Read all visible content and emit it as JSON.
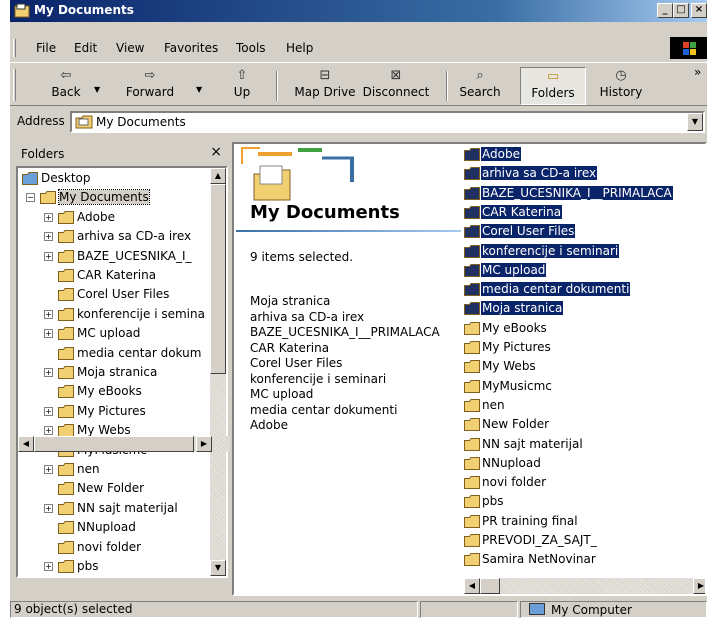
{
  "window": {
    "title": "My Documents"
  },
  "menu": [
    "File",
    "Edit",
    "View",
    "Favorites",
    "Tools",
    "Help"
  ],
  "toolbar": {
    "back": "Back",
    "forward": "Forward",
    "up": "Up",
    "map_drive": "Map Drive",
    "disconnect": "Disconnect",
    "search": "Search",
    "folders": "Folders",
    "history": "History",
    "more": "»"
  },
  "address": {
    "label": "Address",
    "value": "My Documents"
  },
  "folders_pane": {
    "title": "Folders",
    "close": "×",
    "tree": [
      {
        "label": "Desktop",
        "level": 0,
        "expander": ""
      },
      {
        "label": "My Documents",
        "level": 1,
        "expander": "−"
      },
      {
        "label": "Adobe",
        "level": 2,
        "expander": "+"
      },
      {
        "label": "arhiva sa CD-a irex",
        "level": 2,
        "expander": "+"
      },
      {
        "label": "BAZE_UCESNIKA_I_",
        "level": 2,
        "expander": "+"
      },
      {
        "label": "CAR Katerina",
        "level": 2,
        "expander": ""
      },
      {
        "label": "Corel User Files",
        "level": 2,
        "expander": ""
      },
      {
        "label": "konferencije i semina",
        "level": 2,
        "expander": "+"
      },
      {
        "label": "MC upload",
        "level": 2,
        "expander": "+"
      },
      {
        "label": "media centar dokum",
        "level": 2,
        "expander": ""
      },
      {
        "label": "Moja stranica",
        "level": 2,
        "expander": "+"
      },
      {
        "label": "My eBooks",
        "level": 2,
        "expander": ""
      },
      {
        "label": "My Pictures",
        "level": 2,
        "expander": "+"
      },
      {
        "label": "My Webs",
        "level": 2,
        "expander": "+"
      },
      {
        "label": "MyMusicmc",
        "level": 2,
        "expander": ""
      },
      {
        "label": "nen",
        "level": 2,
        "expander": "+"
      },
      {
        "label": "New Folder",
        "level": 2,
        "expander": ""
      },
      {
        "label": "NN sajt materijal",
        "level": 2,
        "expander": "+"
      },
      {
        "label": "NNupload",
        "level": 2,
        "expander": ""
      },
      {
        "label": "novi folder",
        "level": 2,
        "expander": ""
      },
      {
        "label": "pbs",
        "level": 2,
        "expander": "+"
      }
    ]
  },
  "info_panel": {
    "title": "My Documents",
    "status": "9 items selected.",
    "selected_names": [
      "Moja stranica",
      "arhiva sa CD-a irex",
      "BAZE_UCESNIKA_I__PRIMALACA",
      "CAR Katerina",
      "Corel User Files",
      "konferencije i seminari",
      "MC upload",
      "media centar dokumenti",
      "Adobe"
    ]
  },
  "files": [
    {
      "label": "Adobe",
      "selected": true
    },
    {
      "label": "arhiva sa CD-a irex",
      "selected": true
    },
    {
      "label": "BAZE_UCESNIKA_I__PRIMALACA",
      "selected": true
    },
    {
      "label": "CAR Katerina",
      "selected": true
    },
    {
      "label": "Corel User Files",
      "selected": true
    },
    {
      "label": "konferencije i seminari",
      "selected": true
    },
    {
      "label": "MC upload",
      "selected": true
    },
    {
      "label": "media centar dokumenti",
      "selected": true
    },
    {
      "label": "Moja stranica",
      "selected": true
    },
    {
      "label": "My eBooks",
      "selected": false
    },
    {
      "label": "My Pictures",
      "selected": false
    },
    {
      "label": "My Webs",
      "selected": false
    },
    {
      "label": "MyMusicmc",
      "selected": false
    },
    {
      "label": "nen",
      "selected": false
    },
    {
      "label": "New Folder",
      "selected": false
    },
    {
      "label": "NN sajt materijal",
      "selected": false
    },
    {
      "label": "NNupload",
      "selected": false
    },
    {
      "label": "novi folder",
      "selected": false
    },
    {
      "label": "pbs",
      "selected": false
    },
    {
      "label": "PR training final",
      "selected": false
    },
    {
      "label": "PREVODI_ZA_SAJT_",
      "selected": false
    },
    {
      "label": "Samira NetNovinar",
      "selected": false
    }
  ],
  "statusbar": {
    "selection": "9 object(s) selected",
    "zone": "My Computer"
  },
  "colors": {
    "title_bar": "#0a246a",
    "selection": "#0a246a",
    "folder": "#f0d070"
  }
}
